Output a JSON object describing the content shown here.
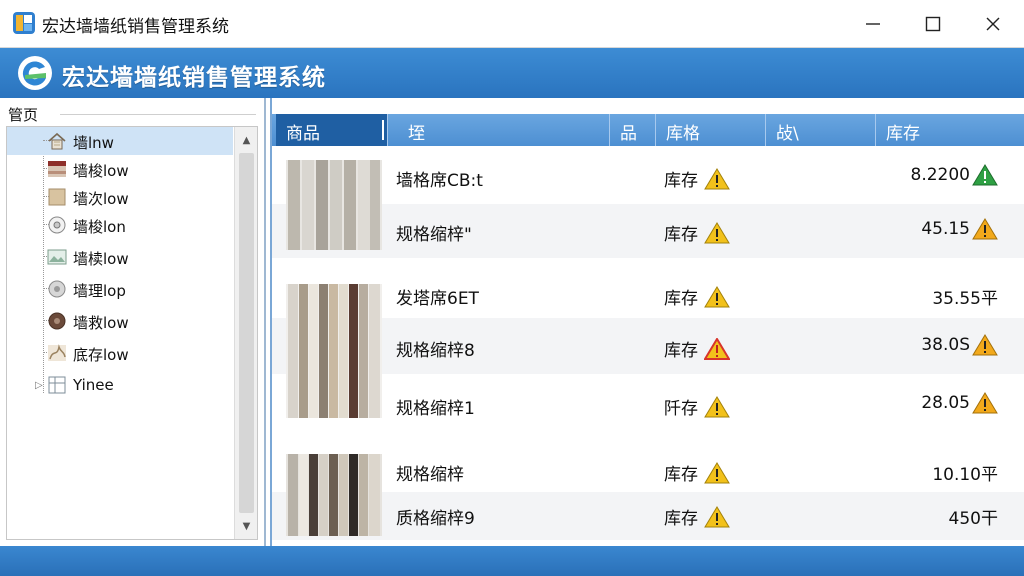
{
  "window": {
    "title": "宏达墙墙纸销售管理系统",
    "header_title": "宏达墙墙纸销售管理系统"
  },
  "left_panel": {
    "title": "管页",
    "tree": [
      {
        "label": "墙lnw",
        "icon": "house-icon",
        "selected": true
      },
      {
        "label": "墙梭low",
        "icon": "wallpaper-swatch-icon",
        "selected": false
      },
      {
        "label": "墙次low",
        "icon": "beige-swatch-icon",
        "selected": false
      },
      {
        "label": "墙梭lon",
        "icon": "disc-icon",
        "selected": false
      },
      {
        "label": "墙椟low",
        "icon": "landscape-icon",
        "selected": false
      },
      {
        "label": "墙理lop",
        "icon": "gray-disc-icon",
        "selected": false
      },
      {
        "label": "墙救low",
        "icon": "brown-disc-icon",
        "selected": false
      },
      {
        "label": "底存low",
        "icon": "floral-icon",
        "selected": false
      },
      {
        "label": "Yinee",
        "icon": "grid-icon",
        "selected": false
      }
    ]
  },
  "grid": {
    "columns": [
      "商品",
      "垤",
      "品",
      "库格",
      "敁\\",
      "库存"
    ],
    "groups": [
      {
        "image": "gray-curtain-thumbnail",
        "rows": [
          {
            "name": "墙格席CB:t",
            "status": "库存",
            "status_icon": "warning-icon",
            "qty": "8.2200",
            "qty_icon": "green-triangle-icon"
          },
          {
            "name": "规格缩梓\"",
            "status": "库存",
            "status_icon": "warning-icon",
            "qty": "45.15",
            "qty_icon": "warning-icon"
          }
        ]
      },
      {
        "image": "multicolor-curtain-thumbnail",
        "rows": [
          {
            "name": "发塔席6ET",
            "status": "库存",
            "status_icon": "warning-icon",
            "qty": "35.55平",
            "qty_icon": ""
          },
          {
            "name": "规格缩梓8",
            "status": "库存",
            "status_icon": "red-warning-icon",
            "qty": "38.0S",
            "qty_icon": "warning-icon"
          },
          {
            "name": "规格缩梓1",
            "status": "阡存",
            "status_icon": "warning-icon",
            "qty": "28.05",
            "qty_icon": "warning-icon"
          }
        ]
      },
      {
        "image": "dark-curtain-thumbnail",
        "rows": [
          {
            "name": "规格缩梓",
            "status": "库存",
            "status_icon": "warning-icon",
            "qty": "10.10平",
            "qty_icon": ""
          },
          {
            "name": "质格缩梓9",
            "status": "库存",
            "status_icon": "warning-icon",
            "qty": "450干",
            "qty_icon": ""
          }
        ]
      }
    ]
  },
  "colors": {
    "accent": "#2e7bc4",
    "header_blue": "#4d8fd2",
    "warning_yellow": "#f2c11b",
    "warning_red": "#d8342a",
    "ok_green": "#2ea043"
  }
}
